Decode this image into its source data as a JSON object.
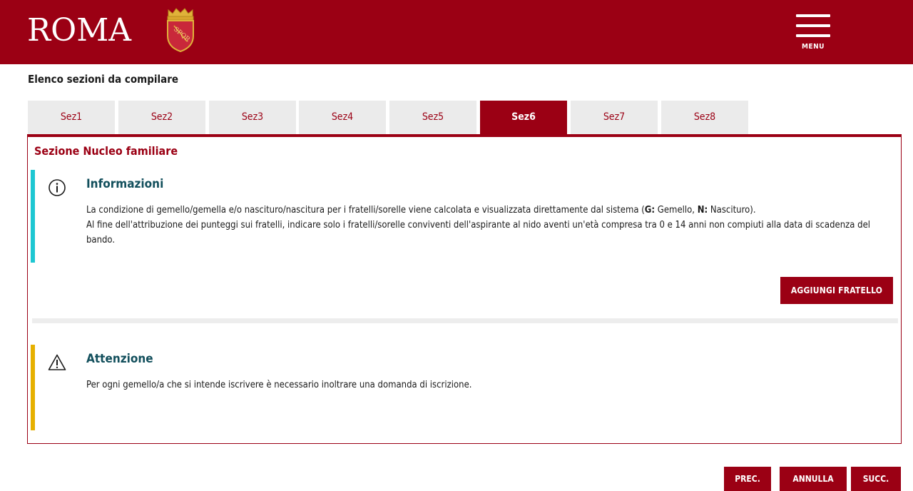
{
  "header": {
    "logo": "ROMA",
    "crest_text": "SPQR",
    "menu_label": "MENU"
  },
  "section_list_title": "Elenco sezioni da compilare",
  "tabs": [
    {
      "label": "Sez1",
      "active": false
    },
    {
      "label": "Sez2",
      "active": false
    },
    {
      "label": "Sez3",
      "active": false
    },
    {
      "label": "Sez4",
      "active": false
    },
    {
      "label": "Sez5",
      "active": false
    },
    {
      "label": "Sez6",
      "active": true
    },
    {
      "label": "Sez7",
      "active": false
    },
    {
      "label": "Sez8",
      "active": false
    }
  ],
  "panel": {
    "title": "Sezione Nucleo familiare",
    "info": {
      "icon": "info-icon",
      "title": "Informazioni",
      "line1_pre": "La condizione di gemello/gemella e/o nascituro/nascitura per i fratelli/sorelle viene calcolata e visualizzata direttamente dal sistema (",
      "g_key": "G:",
      "g_val": " Gemello, ",
      "n_key": "N:",
      "n_val": " Nascituro).",
      "line2": "Al fine dell'attribuzione dei punteggi sui fratelli, indicare solo i fratelli/sorelle conviventi dell'aspirante al nido aventi un'età compresa tra 0 e 14 anni non compiuti alla data di scadenza del bando."
    },
    "add_button": "AGGIUNGI FRATELLO",
    "warning": {
      "icon": "warning-icon",
      "title": "Attenzione",
      "text": "Per ogni gemello/a che si intende iscrivere è necessario inoltrare una domanda di iscrizione."
    }
  },
  "footer": {
    "prev": "PREC.",
    "cancel": "ANNULLA",
    "next": "SUCC."
  },
  "colors": {
    "brand": "#9b0014",
    "info_accent": "#1ec7d2",
    "warning_accent": "#e6b000",
    "heading": "#124f5c"
  }
}
